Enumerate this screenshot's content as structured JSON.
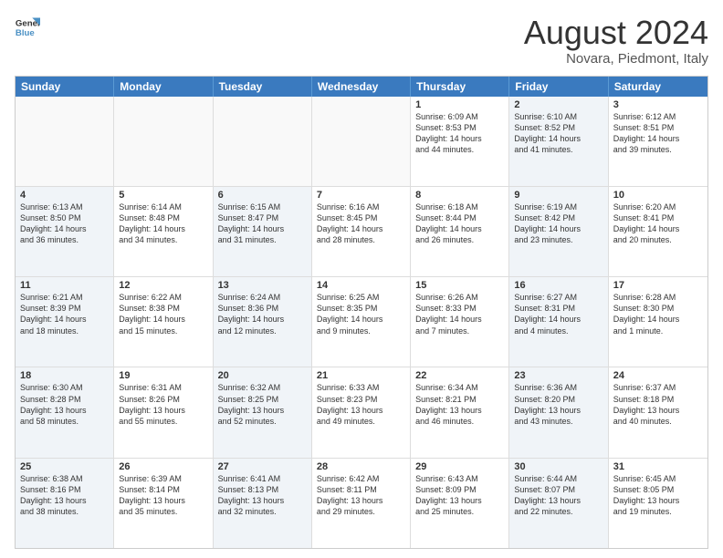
{
  "logo": {
    "line1": "General",
    "line2": "Blue"
  },
  "title": "August 2024",
  "subtitle": "Novara, Piedmont, Italy",
  "header_days": [
    "Sunday",
    "Monday",
    "Tuesday",
    "Wednesday",
    "Thursday",
    "Friday",
    "Saturday"
  ],
  "rows": [
    [
      {
        "day": "",
        "text": "",
        "shaded": false,
        "empty": true
      },
      {
        "day": "",
        "text": "",
        "shaded": false,
        "empty": true
      },
      {
        "day": "",
        "text": "",
        "shaded": false,
        "empty": true
      },
      {
        "day": "",
        "text": "",
        "shaded": false,
        "empty": true
      },
      {
        "day": "1",
        "text": "Sunrise: 6:09 AM\nSunset: 8:53 PM\nDaylight: 14 hours\nand 44 minutes.",
        "shaded": false,
        "empty": false
      },
      {
        "day": "2",
        "text": "Sunrise: 6:10 AM\nSunset: 8:52 PM\nDaylight: 14 hours\nand 41 minutes.",
        "shaded": true,
        "empty": false
      },
      {
        "day": "3",
        "text": "Sunrise: 6:12 AM\nSunset: 8:51 PM\nDaylight: 14 hours\nand 39 minutes.",
        "shaded": false,
        "empty": false
      }
    ],
    [
      {
        "day": "4",
        "text": "Sunrise: 6:13 AM\nSunset: 8:50 PM\nDaylight: 14 hours\nand 36 minutes.",
        "shaded": true,
        "empty": false
      },
      {
        "day": "5",
        "text": "Sunrise: 6:14 AM\nSunset: 8:48 PM\nDaylight: 14 hours\nand 34 minutes.",
        "shaded": false,
        "empty": false
      },
      {
        "day": "6",
        "text": "Sunrise: 6:15 AM\nSunset: 8:47 PM\nDaylight: 14 hours\nand 31 minutes.",
        "shaded": true,
        "empty": false
      },
      {
        "day": "7",
        "text": "Sunrise: 6:16 AM\nSunset: 8:45 PM\nDaylight: 14 hours\nand 28 minutes.",
        "shaded": false,
        "empty": false
      },
      {
        "day": "8",
        "text": "Sunrise: 6:18 AM\nSunset: 8:44 PM\nDaylight: 14 hours\nand 26 minutes.",
        "shaded": false,
        "empty": false
      },
      {
        "day": "9",
        "text": "Sunrise: 6:19 AM\nSunset: 8:42 PM\nDaylight: 14 hours\nand 23 minutes.",
        "shaded": true,
        "empty": false
      },
      {
        "day": "10",
        "text": "Sunrise: 6:20 AM\nSunset: 8:41 PM\nDaylight: 14 hours\nand 20 minutes.",
        "shaded": false,
        "empty": false
      }
    ],
    [
      {
        "day": "11",
        "text": "Sunrise: 6:21 AM\nSunset: 8:39 PM\nDaylight: 14 hours\nand 18 minutes.",
        "shaded": true,
        "empty": false
      },
      {
        "day": "12",
        "text": "Sunrise: 6:22 AM\nSunset: 8:38 PM\nDaylight: 14 hours\nand 15 minutes.",
        "shaded": false,
        "empty": false
      },
      {
        "day": "13",
        "text": "Sunrise: 6:24 AM\nSunset: 8:36 PM\nDaylight: 14 hours\nand 12 minutes.",
        "shaded": true,
        "empty": false
      },
      {
        "day": "14",
        "text": "Sunrise: 6:25 AM\nSunset: 8:35 PM\nDaylight: 14 hours\nand 9 minutes.",
        "shaded": false,
        "empty": false
      },
      {
        "day": "15",
        "text": "Sunrise: 6:26 AM\nSunset: 8:33 PM\nDaylight: 14 hours\nand 7 minutes.",
        "shaded": false,
        "empty": false
      },
      {
        "day": "16",
        "text": "Sunrise: 6:27 AM\nSunset: 8:31 PM\nDaylight: 14 hours\nand 4 minutes.",
        "shaded": true,
        "empty": false
      },
      {
        "day": "17",
        "text": "Sunrise: 6:28 AM\nSunset: 8:30 PM\nDaylight: 14 hours\nand 1 minute.",
        "shaded": false,
        "empty": false
      }
    ],
    [
      {
        "day": "18",
        "text": "Sunrise: 6:30 AM\nSunset: 8:28 PM\nDaylight: 13 hours\nand 58 minutes.",
        "shaded": true,
        "empty": false
      },
      {
        "day": "19",
        "text": "Sunrise: 6:31 AM\nSunset: 8:26 PM\nDaylight: 13 hours\nand 55 minutes.",
        "shaded": false,
        "empty": false
      },
      {
        "day": "20",
        "text": "Sunrise: 6:32 AM\nSunset: 8:25 PM\nDaylight: 13 hours\nand 52 minutes.",
        "shaded": true,
        "empty": false
      },
      {
        "day": "21",
        "text": "Sunrise: 6:33 AM\nSunset: 8:23 PM\nDaylight: 13 hours\nand 49 minutes.",
        "shaded": false,
        "empty": false
      },
      {
        "day": "22",
        "text": "Sunrise: 6:34 AM\nSunset: 8:21 PM\nDaylight: 13 hours\nand 46 minutes.",
        "shaded": false,
        "empty": false
      },
      {
        "day": "23",
        "text": "Sunrise: 6:36 AM\nSunset: 8:20 PM\nDaylight: 13 hours\nand 43 minutes.",
        "shaded": true,
        "empty": false
      },
      {
        "day": "24",
        "text": "Sunrise: 6:37 AM\nSunset: 8:18 PM\nDaylight: 13 hours\nand 40 minutes.",
        "shaded": false,
        "empty": false
      }
    ],
    [
      {
        "day": "25",
        "text": "Sunrise: 6:38 AM\nSunset: 8:16 PM\nDaylight: 13 hours\nand 38 minutes.",
        "shaded": true,
        "empty": false
      },
      {
        "day": "26",
        "text": "Sunrise: 6:39 AM\nSunset: 8:14 PM\nDaylight: 13 hours\nand 35 minutes.",
        "shaded": false,
        "empty": false
      },
      {
        "day": "27",
        "text": "Sunrise: 6:41 AM\nSunset: 8:13 PM\nDaylight: 13 hours\nand 32 minutes.",
        "shaded": true,
        "empty": false
      },
      {
        "day": "28",
        "text": "Sunrise: 6:42 AM\nSunset: 8:11 PM\nDaylight: 13 hours\nand 29 minutes.",
        "shaded": false,
        "empty": false
      },
      {
        "day": "29",
        "text": "Sunrise: 6:43 AM\nSunset: 8:09 PM\nDaylight: 13 hours\nand 25 minutes.",
        "shaded": false,
        "empty": false
      },
      {
        "day": "30",
        "text": "Sunrise: 6:44 AM\nSunset: 8:07 PM\nDaylight: 13 hours\nand 22 minutes.",
        "shaded": true,
        "empty": false
      },
      {
        "day": "31",
        "text": "Sunrise: 6:45 AM\nSunset: 8:05 PM\nDaylight: 13 hours\nand 19 minutes.",
        "shaded": false,
        "empty": false
      }
    ]
  ]
}
